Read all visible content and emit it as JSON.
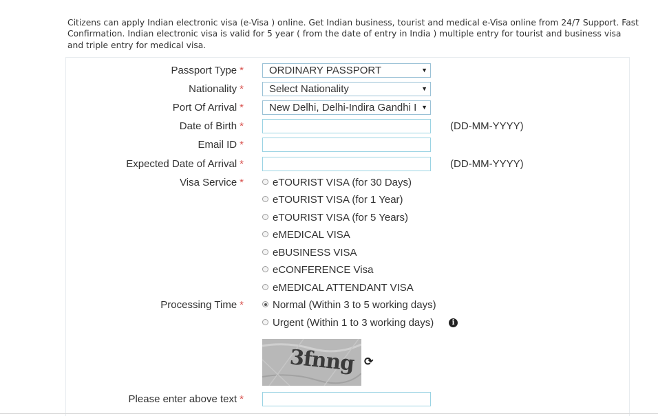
{
  "intro_text": "Citizens can apply Indian electronic visa (e-Visa ) online. Get Indian business, tourist and medical e-Visa online from 24/7 Support. Fast Confirmation. Indian electronic visa is valid for 5 year ( from the date of entry in India ) multiple entry for tourist and business visa and triple entry for medical visa.",
  "required_mark": "*",
  "fields": {
    "passport_type": {
      "label": "Passport Type",
      "value": "ORDINARY PASSPORT"
    },
    "nationality": {
      "label": "Nationality",
      "value": "Select Nationality"
    },
    "port_of_arrival": {
      "label": "Port Of Arrival",
      "value": "New Delhi, Delhi-Indira Gandhi I"
    },
    "date_of_birth": {
      "label": "Date of Birth",
      "value": "",
      "hint": "(DD-MM-YYYY)"
    },
    "email": {
      "label": "Email ID",
      "value": ""
    },
    "expected_arrival": {
      "label": "Expected Date of Arrival",
      "value": "",
      "hint": "(DD-MM-YYYY)"
    }
  },
  "visa_service": {
    "label": "Visa Service",
    "options": [
      "eTOURIST VISA (for 30 Days)",
      "eTOURIST VISA (for 1 Year)",
      "eTOURIST VISA (for 5 Years)",
      "eMEDICAL VISA",
      "eBUSINESS VISA",
      "eCONFERENCE Visa",
      "eMEDICAL ATTENDANT VISA"
    ]
  },
  "processing_time": {
    "label": "Processing Time",
    "options": [
      "Normal (Within 3 to 5 working days)",
      "Urgent (Within 1 to 3 working days)"
    ],
    "selected": 0
  },
  "captcha": {
    "text": "3fnng",
    "input_label": "Please enter above text",
    "value": ""
  },
  "icons": {
    "info": "info-icon",
    "refresh": "refresh-icon",
    "dropdown": "chevron-down-icon"
  }
}
